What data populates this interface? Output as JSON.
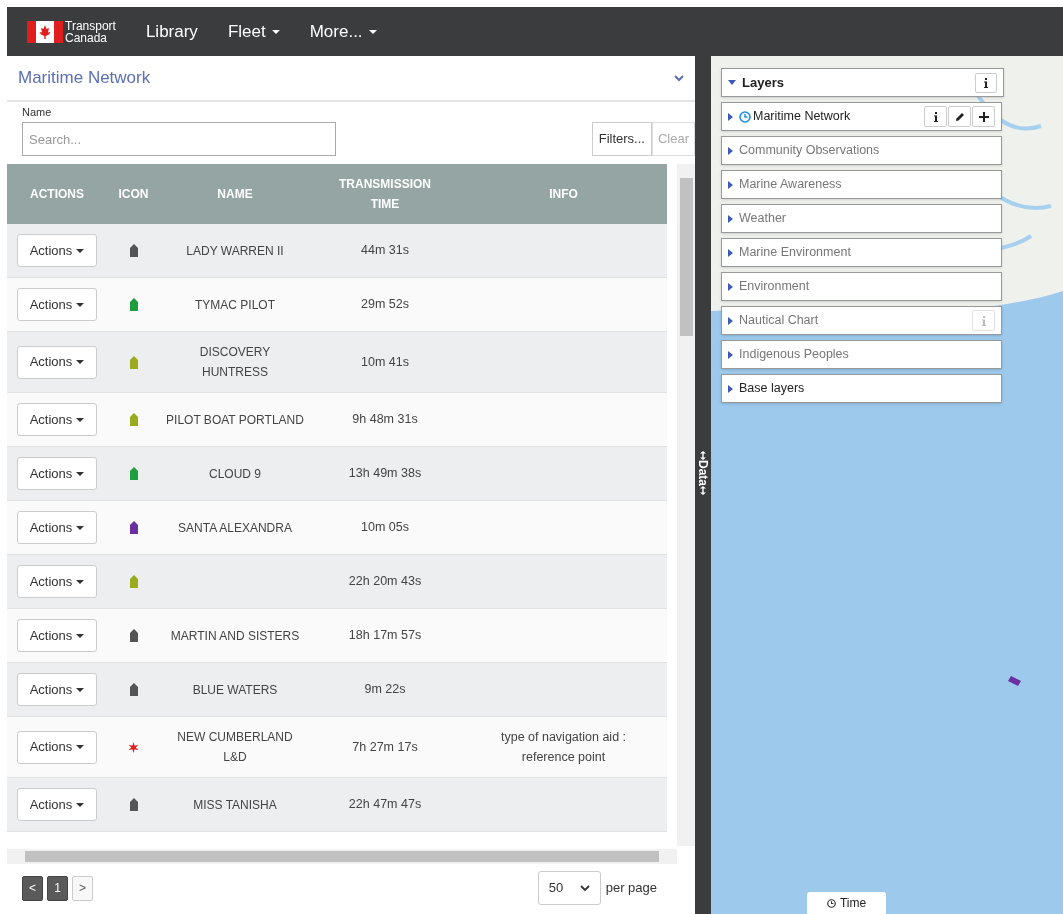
{
  "navbar": {
    "brand": [
      "Transport",
      "Canada"
    ],
    "items": [
      {
        "label": "Library",
        "dropdown": false
      },
      {
        "label": "Fleet",
        "dropdown": true
      },
      {
        "label": "More...",
        "dropdown": true
      }
    ]
  },
  "panel": {
    "title": "Maritime Network",
    "search": {
      "label": "Name",
      "placeholder": "Search..."
    },
    "filters_button": "Filters...",
    "clear_button": "Clear"
  },
  "table": {
    "columns": [
      "ACTIONS",
      "ICON",
      "NAME",
      "TRANSMISSION TIME",
      "INFO"
    ],
    "rows": [
      {
        "action": "Actions",
        "icon": {
          "kind": "vessel",
          "color": "#555555"
        },
        "name": "LADY WARREN II",
        "time": "44m 31s"
      },
      {
        "action": "Actions",
        "icon": {
          "kind": "vessel",
          "color": "#1e9e3e"
        },
        "name": "TYMAC PILOT",
        "time": "29m 52s"
      },
      {
        "action": "Actions",
        "icon": {
          "kind": "vessel",
          "color": "#9aab1c"
        },
        "name": "DISCOVERY HUNTRESS",
        "time": "10m 41s"
      },
      {
        "action": "Actions",
        "icon": {
          "kind": "vessel",
          "color": "#9aab1c"
        },
        "name": "PILOT BOAT PORTLAND",
        "time": "9h 48m 31s"
      },
      {
        "action": "Actions",
        "icon": {
          "kind": "vessel",
          "color": "#1e9e3e"
        },
        "name": "CLOUD 9",
        "time": "13h 49m 38s"
      },
      {
        "action": "Actions",
        "icon": {
          "kind": "vessel",
          "color": "#6b2fa0"
        },
        "name": "SANTA ALEXANDRA",
        "time": "10m 05s"
      },
      {
        "action": "Actions",
        "icon": {
          "kind": "vessel",
          "color": "#9aab1c"
        },
        "time": "22h 20m 43s"
      },
      {
        "action": "Actions",
        "icon": {
          "kind": "vessel",
          "color": "#555555"
        },
        "name": "MARTIN AND SISTERS",
        "time": "18h 17m 57s"
      },
      {
        "action": "Actions",
        "icon": {
          "kind": "vessel",
          "color": "#555555"
        },
        "name": "BLUE WATERS",
        "time": "9m 22s"
      },
      {
        "action": "Actions",
        "icon": {
          "kind": "navaid",
          "color": "#e01e1e"
        },
        "name": "NEW CUMBERLAND L&D",
        "time": "7h 27m 17s",
        "info": "type of navigation aid : reference point"
      },
      {
        "action": "Actions",
        "icon": {
          "kind": "vessel",
          "color": "#555555"
        },
        "name": "MISS TANISHA",
        "time": "22h 47m 47s"
      }
    ]
  },
  "pagination": {
    "pages": [
      {
        "label": "<",
        "kind": "prev"
      },
      {
        "label": "1",
        "kind": "page",
        "selected": true
      },
      {
        "label": ">",
        "kind": "next"
      }
    ],
    "per_page_value": "50",
    "per_page_label": "per page"
  },
  "data_handle": "Data",
  "layers": {
    "title": "Layers",
    "items": [
      {
        "label": "Maritime Network",
        "active": true,
        "clock": true,
        "buttons": [
          {
            "kind": "info"
          },
          {
            "kind": "edit"
          },
          {
            "kind": "add"
          }
        ]
      },
      {
        "label": "Community Observations",
        "active": false
      },
      {
        "label": "Marine Awareness",
        "active": false
      },
      {
        "label": "Weather",
        "active": false
      },
      {
        "label": "Marine Environment",
        "active": false
      },
      {
        "label": "Environment",
        "active": false
      },
      {
        "label": "Nautical Chart",
        "active": false,
        "buttons": [
          {
            "kind": "info",
            "disabled": true
          }
        ]
      },
      {
        "label": "Indigenous Peoples",
        "active": false
      },
      {
        "label": "Base layers",
        "active": true
      }
    ]
  },
  "time_button": "Time"
}
